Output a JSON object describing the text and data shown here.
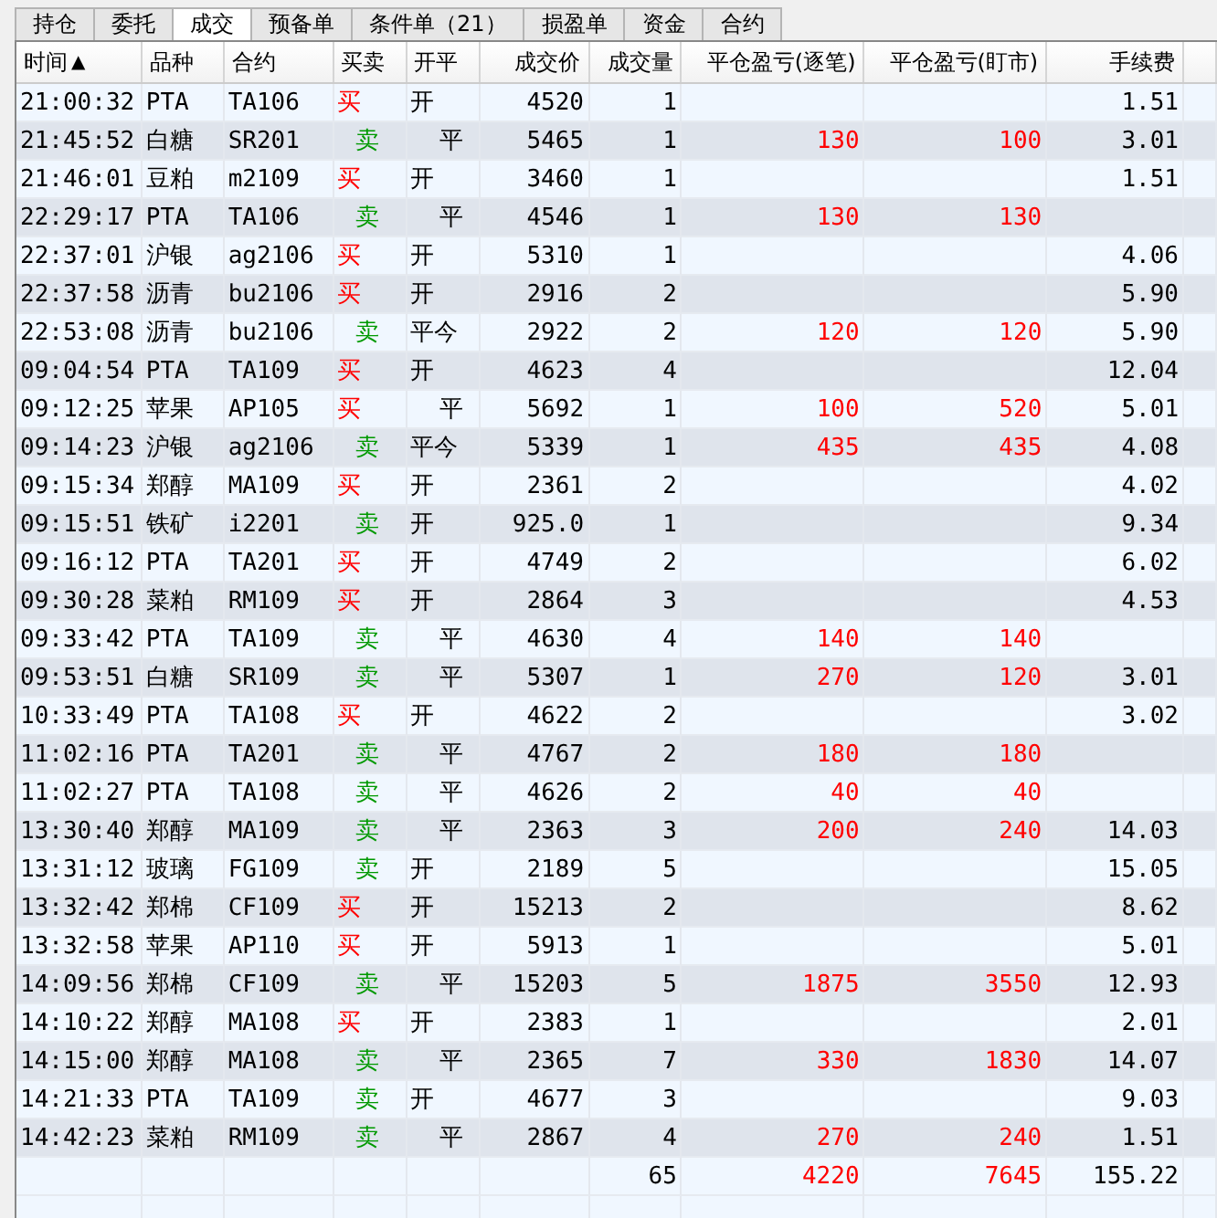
{
  "tabs": [
    {
      "label": "持仓",
      "selected": false
    },
    {
      "label": "委托",
      "selected": false
    },
    {
      "label": "成交",
      "selected": true
    },
    {
      "label": "预备单",
      "selected": false
    },
    {
      "label": "条件单（21）",
      "selected": false
    },
    {
      "label": "损盈单",
      "selected": false
    },
    {
      "label": "资金",
      "selected": false
    },
    {
      "label": "合约",
      "selected": false
    }
  ],
  "table": {
    "columns": [
      {
        "label": "时间",
        "sort_indicator": "▲"
      },
      {
        "label": "品种"
      },
      {
        "label": "合约"
      },
      {
        "label": "买卖"
      },
      {
        "label": "开平"
      },
      {
        "label": "成交价"
      },
      {
        "label": "成交量"
      },
      {
        "label": "平仓盈亏(逐笔)"
      },
      {
        "label": "平仓盈亏(盯市)"
      },
      {
        "label": "手续费"
      }
    ],
    "rows": [
      {
        "time": "21:00:32",
        "product": "PTA",
        "contract": "TA106",
        "direction": {
          "kind": "buy",
          "label": "买"
        },
        "offset": {
          "kind": "open",
          "label": "开"
        },
        "price": "4520",
        "volume": "1",
        "fee": "1.51"
      },
      {
        "time": "21:45:52",
        "product": "白糖",
        "contract": "SR201",
        "direction": {
          "kind": "sell",
          "label": "卖"
        },
        "offset": {
          "kind": "close",
          "label": "平"
        },
        "price": "5465",
        "volume": "1",
        "pnl_trade": "130",
        "pnl_mark": "100",
        "fee": "3.01"
      },
      {
        "time": "21:46:01",
        "product": "豆粕",
        "contract": "m2109",
        "direction": {
          "kind": "buy",
          "label": "买"
        },
        "offset": {
          "kind": "open",
          "label": "开"
        },
        "price": "3460",
        "volume": "1",
        "fee": "1.51"
      },
      {
        "time": "22:29:17",
        "product": "PTA",
        "contract": "TA106",
        "direction": {
          "kind": "sell",
          "label": "卖"
        },
        "offset": {
          "kind": "close",
          "label": "平"
        },
        "price": "4546",
        "volume": "1",
        "pnl_trade": "130",
        "pnl_mark": "130"
      },
      {
        "time": "22:37:01",
        "product": "沪银",
        "contract": "ag2106",
        "direction": {
          "kind": "buy",
          "label": "买"
        },
        "offset": {
          "kind": "open",
          "label": "开"
        },
        "price": "5310",
        "volume": "1",
        "fee": "4.06"
      },
      {
        "time": "22:37:58",
        "product": "沥青",
        "contract": "bu2106",
        "direction": {
          "kind": "buy",
          "label": "买"
        },
        "offset": {
          "kind": "open",
          "label": "开"
        },
        "price": "2916",
        "volume": "2",
        "fee": "5.90"
      },
      {
        "time": "22:53:08",
        "product": "沥青",
        "contract": "bu2106",
        "direction": {
          "kind": "sell",
          "label": "卖"
        },
        "offset": {
          "kind": "close_today",
          "label": "平今"
        },
        "price": "2922",
        "volume": "2",
        "pnl_trade": "120",
        "pnl_mark": "120",
        "fee": "5.90"
      },
      {
        "time": "09:04:54",
        "product": "PTA",
        "contract": "TA109",
        "direction": {
          "kind": "buy",
          "label": "买"
        },
        "offset": {
          "kind": "open",
          "label": "开"
        },
        "price": "4623",
        "volume": "4",
        "fee": "12.04"
      },
      {
        "time": "09:12:25",
        "product": "苹果",
        "contract": "AP105",
        "direction": {
          "kind": "buy",
          "label": "买"
        },
        "offset": {
          "kind": "close",
          "label": "平"
        },
        "price": "5692",
        "volume": "1",
        "pnl_trade": "100",
        "pnl_mark": "520",
        "fee": "5.01"
      },
      {
        "time": "09:14:23",
        "product": "沪银",
        "contract": "ag2106",
        "direction": {
          "kind": "sell",
          "label": "卖"
        },
        "offset": {
          "kind": "close_today",
          "label": "平今"
        },
        "price": "5339",
        "volume": "1",
        "pnl_trade": "435",
        "pnl_mark": "435",
        "fee": "4.08"
      },
      {
        "time": "09:15:34",
        "product": "郑醇",
        "contract": "MA109",
        "direction": {
          "kind": "buy",
          "label": "买"
        },
        "offset": {
          "kind": "open",
          "label": "开"
        },
        "price": "2361",
        "volume": "2",
        "fee": "4.02"
      },
      {
        "time": "09:15:51",
        "product": "铁矿",
        "contract": "i2201",
        "direction": {
          "kind": "sell",
          "label": "卖"
        },
        "offset": {
          "kind": "open",
          "label": "开"
        },
        "price": "925.0",
        "volume": "1",
        "fee": "9.34"
      },
      {
        "time": "09:16:12",
        "product": "PTA",
        "contract": "TA201",
        "direction": {
          "kind": "buy",
          "label": "买"
        },
        "offset": {
          "kind": "open",
          "label": "开"
        },
        "price": "4749",
        "volume": "2",
        "fee": "6.02"
      },
      {
        "time": "09:30:28",
        "product": "菜粕",
        "contract": "RM109",
        "direction": {
          "kind": "buy",
          "label": "买"
        },
        "offset": {
          "kind": "open",
          "label": "开"
        },
        "price": "2864",
        "volume": "3",
        "fee": "4.53"
      },
      {
        "time": "09:33:42",
        "product": "PTA",
        "contract": "TA109",
        "direction": {
          "kind": "sell",
          "label": "卖"
        },
        "offset": {
          "kind": "close",
          "label": "平"
        },
        "price": "4630",
        "volume": "4",
        "pnl_trade": "140",
        "pnl_mark": "140"
      },
      {
        "time": "09:53:51",
        "product": "白糖",
        "contract": "SR109",
        "direction": {
          "kind": "sell",
          "label": "卖"
        },
        "offset": {
          "kind": "close",
          "label": "平"
        },
        "price": "5307",
        "volume": "1",
        "pnl_trade": "270",
        "pnl_mark": "120",
        "fee": "3.01"
      },
      {
        "time": "10:33:49",
        "product": "PTA",
        "contract": "TA108",
        "direction": {
          "kind": "buy",
          "label": "买"
        },
        "offset": {
          "kind": "open",
          "label": "开"
        },
        "price": "4622",
        "volume": "2",
        "fee": "3.02"
      },
      {
        "time": "11:02:16",
        "product": "PTA",
        "contract": "TA201",
        "direction": {
          "kind": "sell",
          "label": "卖"
        },
        "offset": {
          "kind": "close",
          "label": "平"
        },
        "price": "4767",
        "volume": "2",
        "pnl_trade": "180",
        "pnl_mark": "180"
      },
      {
        "time": "11:02:27",
        "product": "PTA",
        "contract": "TA108",
        "direction": {
          "kind": "sell",
          "label": "卖"
        },
        "offset": {
          "kind": "close",
          "label": "平"
        },
        "price": "4626",
        "volume": "2",
        "pnl_trade": "40",
        "pnl_mark": "40"
      },
      {
        "time": "13:30:40",
        "product": "郑醇",
        "contract": "MA109",
        "direction": {
          "kind": "sell",
          "label": "卖"
        },
        "offset": {
          "kind": "close",
          "label": "平"
        },
        "price": "2363",
        "volume": "3",
        "pnl_trade": "200",
        "pnl_mark": "240",
        "fee": "14.03"
      },
      {
        "time": "13:31:12",
        "product": "玻璃",
        "contract": "FG109",
        "direction": {
          "kind": "sell",
          "label": "卖"
        },
        "offset": {
          "kind": "open",
          "label": "开"
        },
        "price": "2189",
        "volume": "5",
        "fee": "15.05"
      },
      {
        "time": "13:32:42",
        "product": "郑棉",
        "contract": "CF109",
        "direction": {
          "kind": "buy",
          "label": "买"
        },
        "offset": {
          "kind": "open",
          "label": "开"
        },
        "price": "15213",
        "volume": "2",
        "fee": "8.62"
      },
      {
        "time": "13:32:58",
        "product": "苹果",
        "contract": "AP110",
        "direction": {
          "kind": "buy",
          "label": "买"
        },
        "offset": {
          "kind": "open",
          "label": "开"
        },
        "price": "5913",
        "volume": "1",
        "fee": "5.01"
      },
      {
        "time": "14:09:56",
        "product": "郑棉",
        "contract": "CF109",
        "direction": {
          "kind": "sell",
          "label": "卖"
        },
        "offset": {
          "kind": "close",
          "label": "平"
        },
        "price": "15203",
        "volume": "5",
        "pnl_trade": "1875",
        "pnl_mark": "3550",
        "fee": "12.93"
      },
      {
        "time": "14:10:22",
        "product": "郑醇",
        "contract": "MA108",
        "direction": {
          "kind": "buy",
          "label": "买"
        },
        "offset": {
          "kind": "open",
          "label": "开"
        },
        "price": "2383",
        "volume": "1",
        "fee": "2.01"
      },
      {
        "time": "14:15:00",
        "product": "郑醇",
        "contract": "MA108",
        "direction": {
          "kind": "sell",
          "label": "卖"
        },
        "offset": {
          "kind": "close",
          "label": "平"
        },
        "price": "2365",
        "volume": "7",
        "pnl_trade": "330",
        "pnl_mark": "1830",
        "fee": "14.07"
      },
      {
        "time": "14:21:33",
        "product": "PTA",
        "contract": "TA109",
        "direction": {
          "kind": "sell",
          "label": "卖"
        },
        "offset": {
          "kind": "open",
          "label": "开"
        },
        "price": "4677",
        "volume": "3",
        "fee": "9.03"
      },
      {
        "time": "14:42:23",
        "product": "菜粕",
        "contract": "RM109",
        "direction": {
          "kind": "sell",
          "label": "卖"
        },
        "offset": {
          "kind": "close",
          "label": "平"
        },
        "price": "2867",
        "volume": "4",
        "pnl_trade": "270",
        "pnl_mark": "240",
        "fee": "1.51"
      }
    ],
    "totals": {
      "volume": "65",
      "pnl_trade": "4220",
      "pnl_mark": "7645",
      "fee": "155.22"
    }
  }
}
